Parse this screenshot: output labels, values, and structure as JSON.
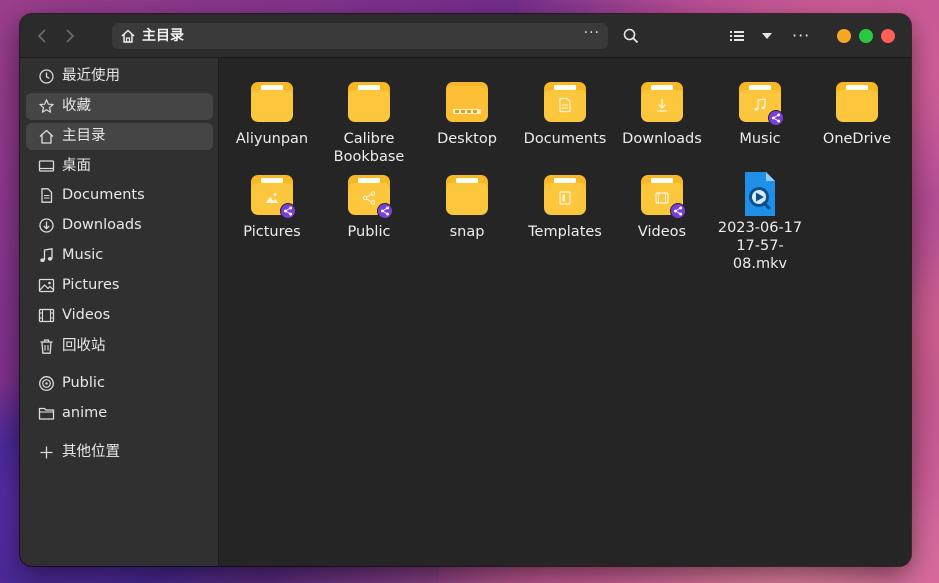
{
  "window": {
    "path_label": "主目录",
    "traffic_colors": [
      "#f5a623",
      "#27c93f",
      "#ff5f57"
    ]
  },
  "toolbar": {
    "back_icon": "chevron-left-icon",
    "forward_icon": "chevron-right-icon",
    "path_more": "···",
    "menu_more": "···"
  },
  "sidebar": {
    "items": [
      {
        "label": "最近使用",
        "icon": "clock-icon"
      },
      {
        "label": "收藏",
        "icon": "star-icon"
      },
      {
        "label": "主目录",
        "icon": "home-icon",
        "selected": true
      },
      {
        "label": "桌面",
        "icon": "desktop-icon"
      },
      {
        "label": "Documents",
        "icon": "document-icon"
      },
      {
        "label": "Downloads",
        "icon": "download-icon"
      },
      {
        "label": "Music",
        "icon": "music-icon"
      },
      {
        "label": "Pictures",
        "icon": "picture-icon"
      },
      {
        "label": "Videos",
        "icon": "video-icon"
      },
      {
        "label": "回收站",
        "icon": "trash-icon"
      },
      {
        "label": "Public",
        "icon": "network-icon"
      },
      {
        "label": "anime",
        "icon": "folder-icon"
      },
      {
        "label": "其他位置",
        "icon": "plus-icon"
      }
    ]
  },
  "files": [
    {
      "name": "Aliyunpan",
      "type": "folder"
    },
    {
      "name": "Calibre Bookbase",
      "type": "folder"
    },
    {
      "name": "Desktop",
      "type": "folder-desktop"
    },
    {
      "name": "Documents",
      "type": "folder-documents"
    },
    {
      "name": "Downloads",
      "type": "folder-downloads"
    },
    {
      "name": "Music",
      "type": "folder-music",
      "shared": true
    },
    {
      "name": "OneDrive",
      "type": "folder"
    },
    {
      "name": "Pictures",
      "type": "folder-pictures",
      "shared": true
    },
    {
      "name": "Public",
      "type": "folder-public",
      "shared": true
    },
    {
      "name": "snap",
      "type": "folder"
    },
    {
      "name": "Templates",
      "type": "folder-templates"
    },
    {
      "name": "Videos",
      "type": "folder-videos",
      "shared": true
    },
    {
      "name": "2023-06-17 17-57-08.mkv",
      "type": "video-file"
    }
  ],
  "colors": {
    "folder": "#fcc43c",
    "share_badge": "#7a3fd6",
    "video_file": "#1e8fe6"
  }
}
